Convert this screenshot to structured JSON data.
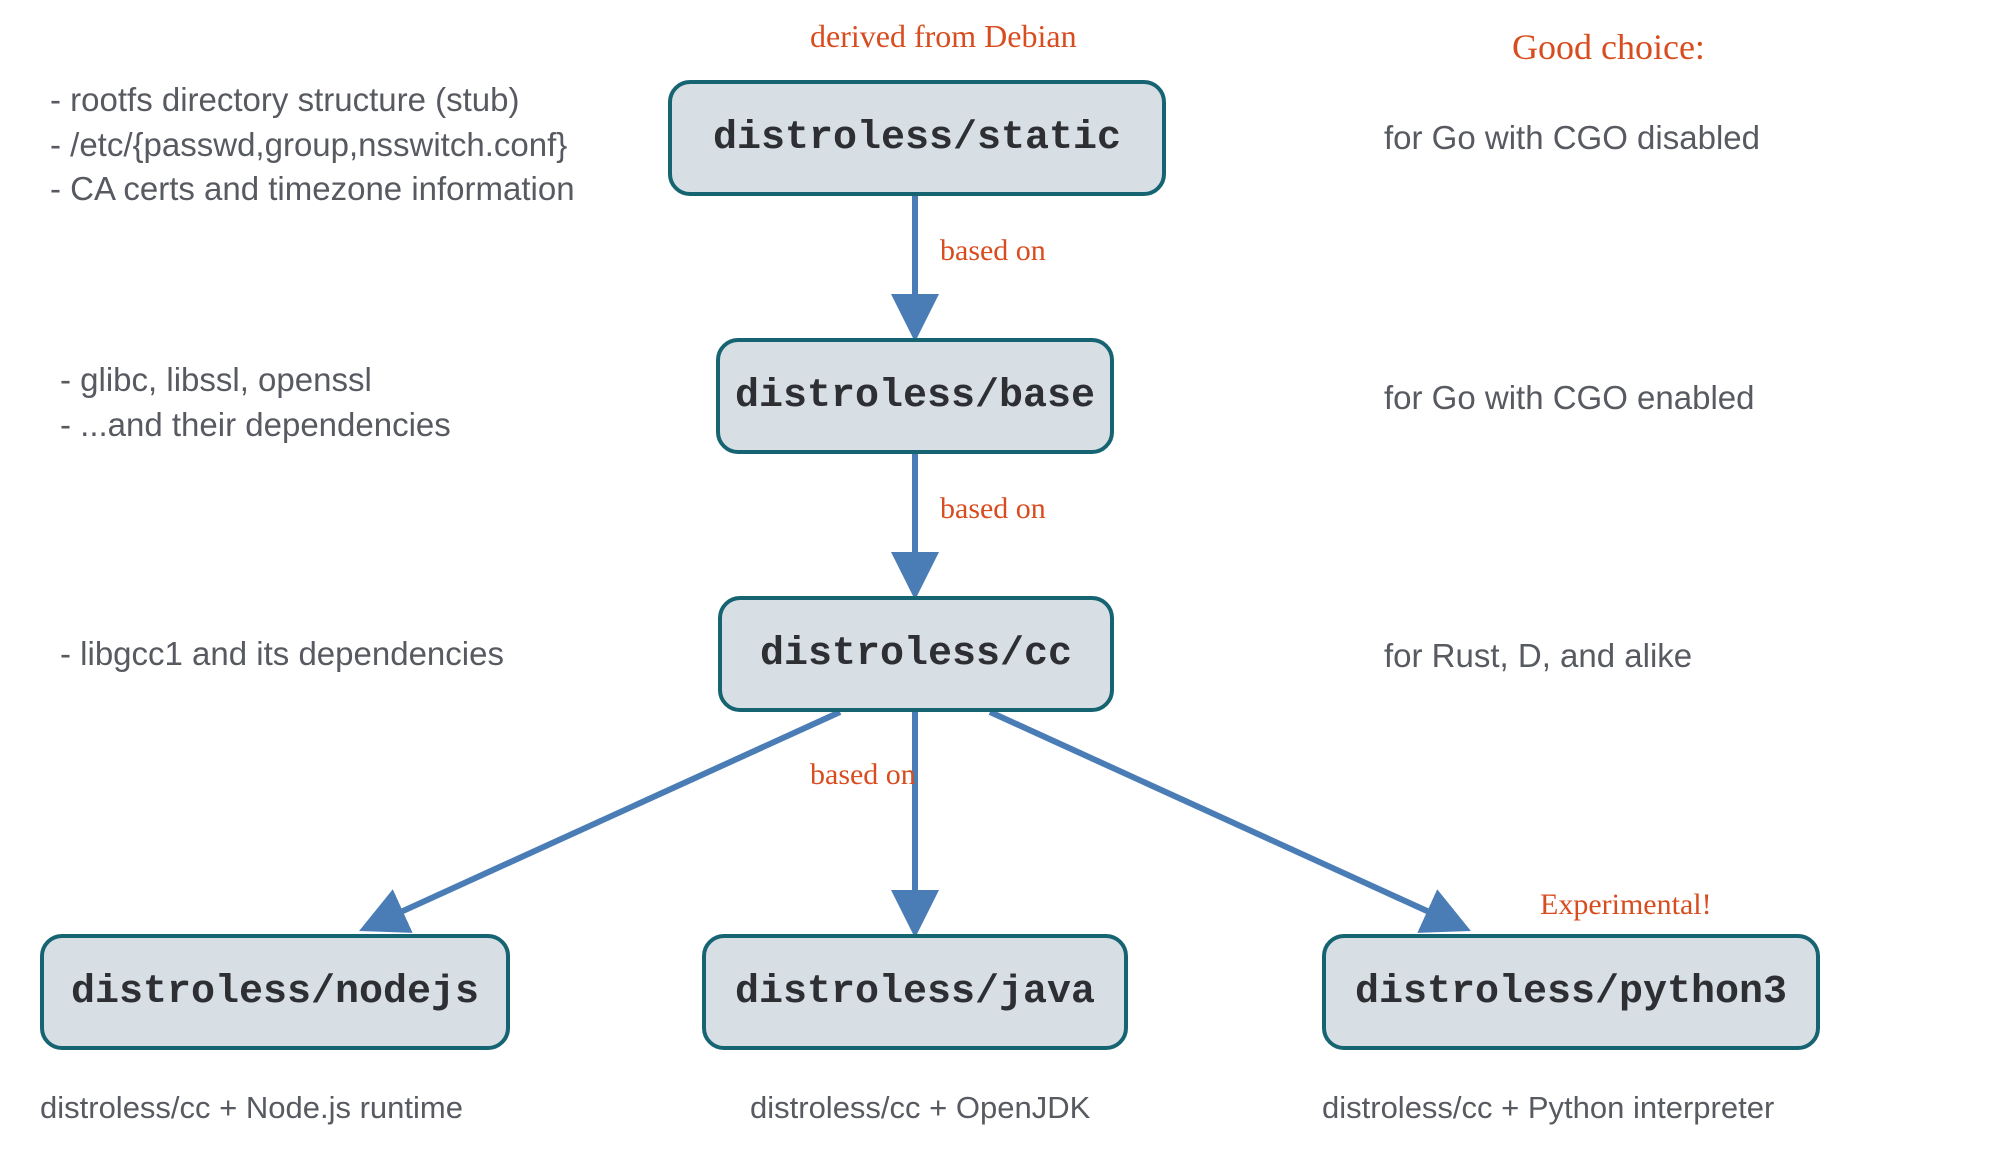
{
  "annotations": {
    "derived_from": "derived from Debian",
    "good_choice_header": "Good choice:",
    "based_on_1": "based on",
    "based_on_2": "based on",
    "based_on_3": "based on",
    "experimental": "Experimental!"
  },
  "nodes": {
    "static": {
      "label": "distroless/static",
      "left_desc": "- rootfs directory structure (stub)\n- /etc/{passwd,group,nsswitch.conf}\n- CA certs and timezone information",
      "right_desc": "for Go with CGO disabled"
    },
    "base": {
      "label": "distroless/base",
      "left_desc": "- glibc, libssl, openssl\n- ...and their dependencies",
      "right_desc": "for Go with CGO enabled"
    },
    "cc": {
      "label": "distroless/cc",
      "left_desc": "- libgcc1 and its dependencies",
      "right_desc": "for Rust, D, and alike"
    },
    "nodejs": {
      "label": "distroless/nodejs",
      "caption": "distroless/cc + Node.js runtime"
    },
    "java": {
      "label": "distroless/java",
      "caption": "distroless/cc + OpenJDK"
    },
    "python3": {
      "label": "distroless/python3",
      "caption": "distroless/cc + Python interpreter"
    }
  }
}
